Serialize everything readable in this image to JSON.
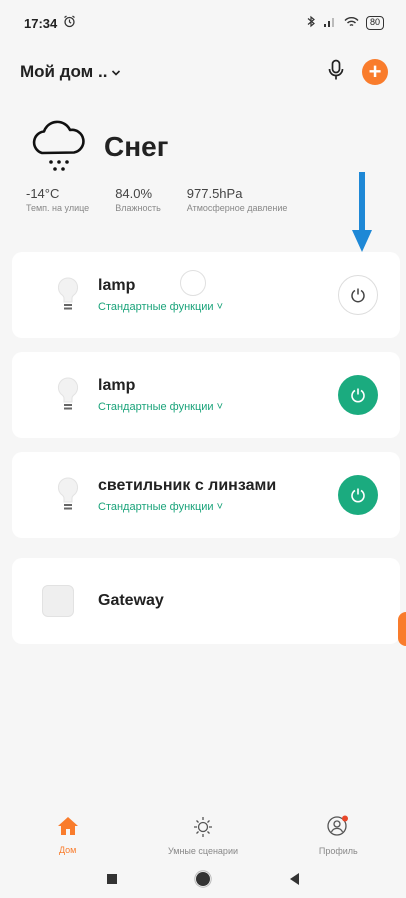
{
  "status": {
    "time": "17:34",
    "battery": "80"
  },
  "header": {
    "home": "Мой дом .."
  },
  "weather": {
    "condition": "Снег",
    "stats": [
      {
        "value": "-14°C",
        "label": "Темп. на улице"
      },
      {
        "value": "84.0%",
        "label": "Влажность"
      },
      {
        "value": "977.5hPa",
        "label": "Атмосферное давление"
      }
    ]
  },
  "devices": [
    {
      "name": "lamp",
      "func": "Стандартные функции ˅",
      "power": "off"
    },
    {
      "name": "lamp",
      "func": "Стандартные функции ˅",
      "power": "on"
    },
    {
      "name": "светильник с линзами",
      "func": "Стандартные функции ˅",
      "power": "on"
    }
  ],
  "gateway": {
    "name": "Gateway"
  },
  "nav": [
    {
      "label": "Дом",
      "icon": "home-icon",
      "active": true
    },
    {
      "label": "Умные сценарии",
      "icon": "sun-icon",
      "active": false
    },
    {
      "label": "Профиль",
      "icon": "profile-icon",
      "active": false
    }
  ],
  "colors": {
    "accent": "#f97c2c",
    "on": "#1bab7f",
    "func": "#1aa37a",
    "annotation": "#1e88d6"
  }
}
